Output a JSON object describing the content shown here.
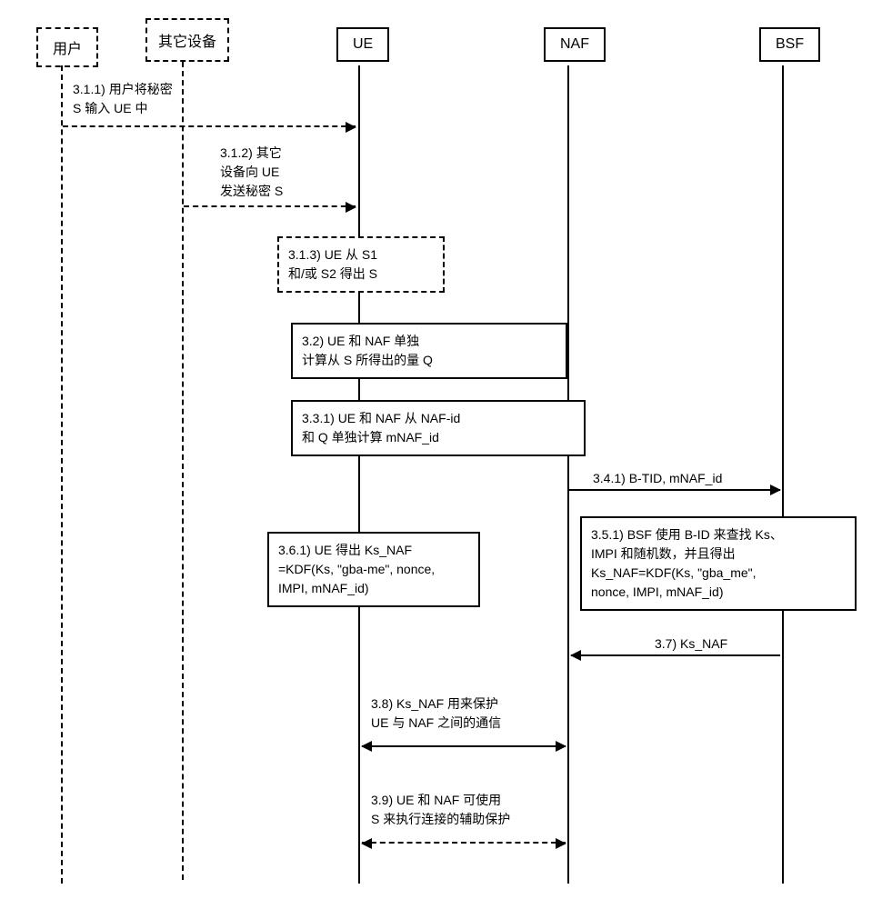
{
  "participants": {
    "user": "用户",
    "other": "其它设备",
    "ue": "UE",
    "naf": "NAF",
    "bsf": "BSF"
  },
  "steps": {
    "s311": "3.1.1) 用户将秘密\nS 输入 UE 中",
    "s312": "3.1.2) 其它\n设备向 UE\n发送秘密 S",
    "s313": "3.1.3) UE 从 S1\n和/或 S2 得出 S",
    "s32": "3.2) UE 和 NAF 单独\n计算从 S 所得出的量 Q",
    "s331": "3.3.1) UE 和 NAF 从 NAF-id\n和 Q 单独计算 mNAF_id",
    "s341": "3.4.1) B-TID, mNAF_id",
    "s351": "3.5.1) BSF 使用 B-ID 来查找 Ks、\nIMPI 和随机数，并且得出\nKs_NAF=KDF(Ks, \"gba_me\",\nnonce, IMPI, mNAF_id)",
    "s361": "3.6.1) UE 得出 Ks_NAF\n=KDF(Ks, \"gba-me\", nonce,\nIMPI, mNAF_id)",
    "s37": "3.7) Ks_NAF",
    "s38": "3.8) Ks_NAF 用来保护\nUE 与 NAF 之间的通信",
    "s39": "3.9) UE 和 NAF 可使用\nS 来执行连接的辅助保护"
  }
}
